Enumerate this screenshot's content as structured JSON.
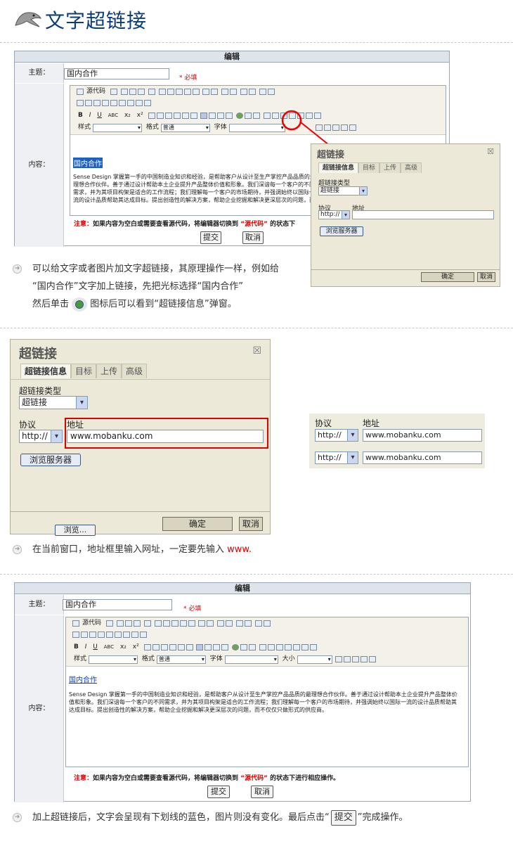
{
  "page": {
    "title": "文字超链接"
  },
  "editor_labels": {
    "panel_title": "编辑",
    "subject_label": "主题：",
    "content_label": "内容："
  },
  "editor": {
    "subject_value": "国内合作",
    "required": "* 必填",
    "toolbar_source": "源代码",
    "toolbar_bold": "B",
    "toolbar_italic": "I",
    "toolbar_underline": "U",
    "toolbar_abc": "ABC",
    "toolbar_sub": "x₂",
    "toolbar_sup": "x²",
    "style_label": "样式",
    "format_label": "格式",
    "format_value": "普通",
    "font_label": "字体",
    "size_label": "大小",
    "link_text": "国内合作",
    "body_text": "Sense Design 掌握第一手的中国制造业知识和经验，是帮助客户从设计至生产掌控产品品质的最理想合作伙伴。善于通过设计帮助本土企业提升产品整体价值和形象。我们深谙每一个客户的不同需求，并为其项目构架是适合的工作流程；我们理解每一个客户的市场期待，并强调始终以国际一流的设计品质帮助其达成目标。提出创造性的解决方案，帮助企业挖掘和解决更深层次的问题，而不仅仅只做形式的供应商。",
    "body_text_short": "Sense Design 掌握第一手的中国制造业知识和经验，是帮助客户从设计至生产掌控产品品质的最理想合作伙伴。善于通过设计帮助本土企业提升产品整体价值和形象。我们深谙每一个客户的不同需求，并为其项目构架是适合的工作流程；我们理解每一个客户的市场期待，并强调始终以国际一流的设计品质帮助其达成目标。提出创造性的解决方案，帮助企业挖掘和解决更深层次的问题，而不仅仅只做形式的供应商。",
    "note_prefix": "注意：",
    "note_main": "如果内容为空白或需要查看源代码，将编辑器切换到",
    "note_source": "“源代码”",
    "note_suffix": "的状态下进行相应操作。",
    "note_suffix_short": "的状态下",
    "submit": "提交",
    "cancel": "取消"
  },
  "dialog": {
    "title": "超链接",
    "tabs": [
      "超链接信息",
      "目标",
      "上传",
      "高级"
    ],
    "type_label": "超链接类型",
    "type_value": "超链接",
    "protocol_label": "协议",
    "protocol_value": "http://",
    "url_label": "地址",
    "url_value": "www.mobanku.com",
    "browse": "浏览服务器",
    "browse2": "浏览...",
    "ok": "确定",
    "cancel": "取消"
  },
  "steps": {
    "step1_line1": "可以给文字或者图片加文字超链接，其原理操作一样，例如给",
    "step1_line2": "“国内合作”文字加上链接，先把光标选择“国内合作”",
    "step1_line3a": "然后单击",
    "step1_line3b": "图标后可以看到“超链接信息”弹窗。",
    "step2_a": "在当前窗口，地址框里输入网址，一定要先输入",
    "step2_b": "www.",
    "step3_a": "加上超链接后，文字会呈现有下划线的蓝色，图片则没有变化。最后点击“",
    "step3_btn": "提交",
    "step3_b": "”完成操作。"
  },
  "colors": {
    "title": "#0b3d7a",
    "accent_red": "#dd0000",
    "link": "#1040b0"
  }
}
